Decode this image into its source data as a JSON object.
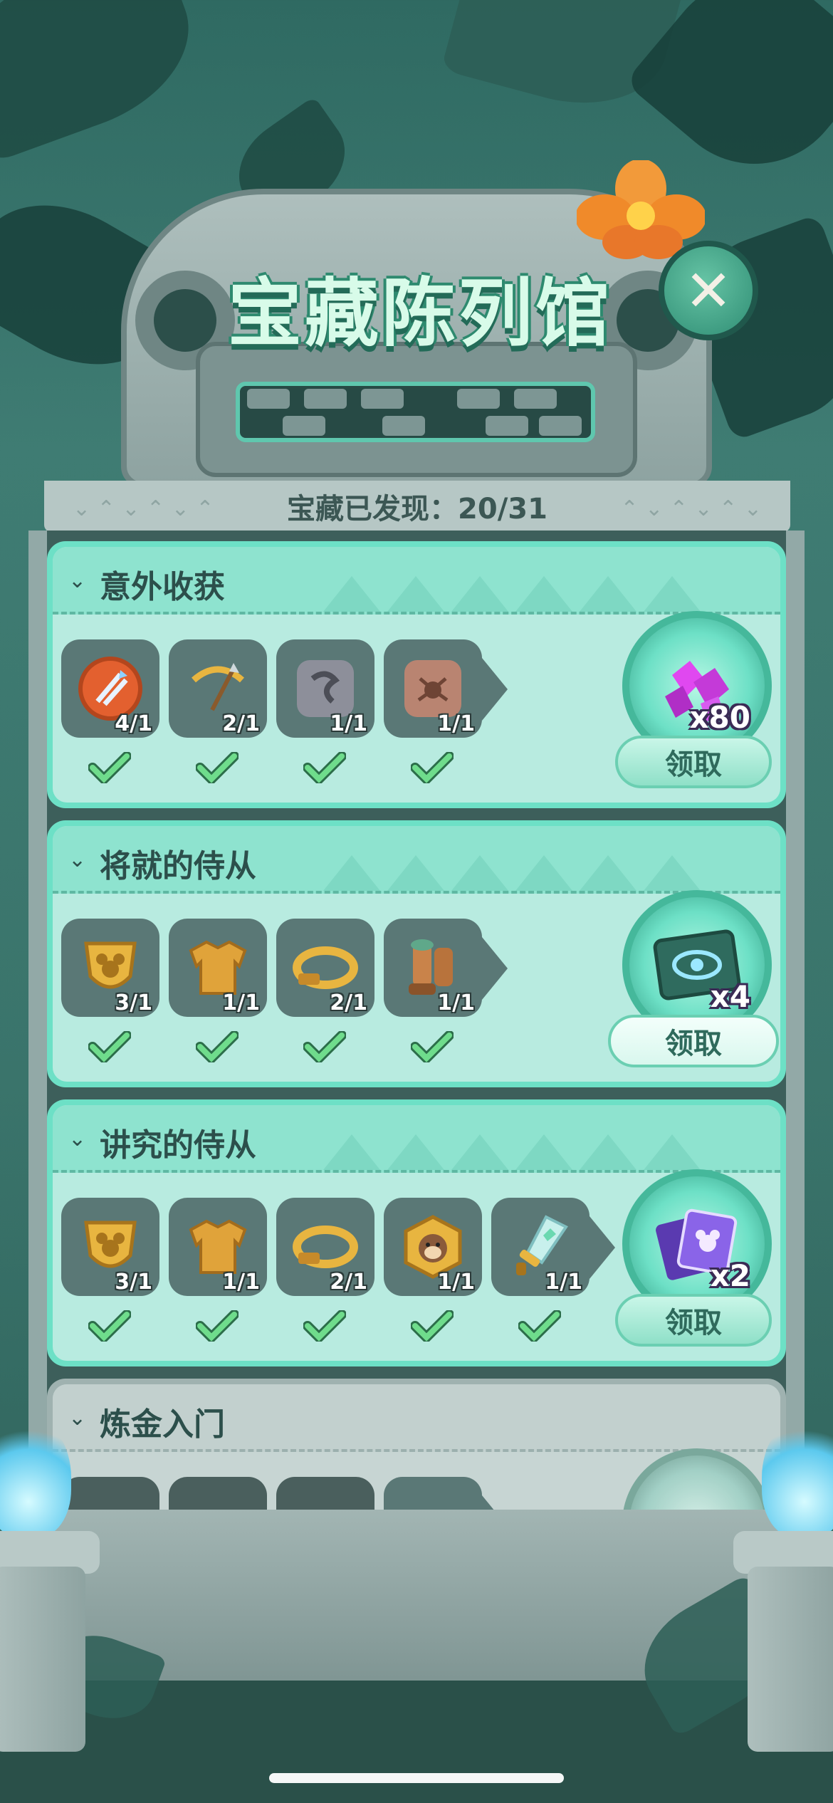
{
  "header": {
    "title": "宝藏陈列馆",
    "close_label": "✕",
    "progress_text": "宝藏已发现：20/31"
  },
  "collections": [
    {
      "title": "意外收获",
      "items": [
        {
          "icon": "arrows-medal-icon",
          "count": "4/1"
        },
        {
          "icon": "golden-bow-icon",
          "count": "2/1"
        },
        {
          "icon": "snake-stone-icon",
          "count": "1/1"
        },
        {
          "icon": "spider-stone-icon",
          "count": "1/1"
        }
      ],
      "reward": {
        "icon": "purple-gems-icon",
        "multiplier": "x80",
        "color": "#c43ad8"
      },
      "claim_label": "领取"
    },
    {
      "title": "将就的侍从",
      "items": [
        {
          "icon": "mickey-shield-icon",
          "count": "3/1"
        },
        {
          "icon": "golden-armor-icon",
          "count": "1/1"
        },
        {
          "icon": "golden-belt-icon",
          "count": "2/1"
        },
        {
          "icon": "bronze-boots-icon",
          "count": "1/1"
        }
      ],
      "reward": {
        "icon": "eye-card-icon",
        "multiplier": "x4",
        "color": "#2f6b5e"
      },
      "claim_label": "领取"
    },
    {
      "title": "讲究的侍从",
      "items": [
        {
          "icon": "mickey-shield-icon",
          "count": "3/1"
        },
        {
          "icon": "golden-armor-icon",
          "count": "1/1"
        },
        {
          "icon": "golden-belt-icon",
          "count": "2/1"
        },
        {
          "icon": "monkey-badge-icon",
          "count": "1/1"
        },
        {
          "icon": "crystal-sword-icon",
          "count": "1/1"
        }
      ],
      "reward": {
        "icon": "disney-cards-icon",
        "multiplier": "x2",
        "color": "#7a52d8"
      },
      "claim_label": "领取"
    },
    {
      "title": "炼金入门",
      "items": [],
      "reward": null,
      "claim_label": ""
    }
  ],
  "colors": {
    "accent": "#6de0c6",
    "check": "#6fdc8c",
    "title_text": "#d8fbe9"
  }
}
